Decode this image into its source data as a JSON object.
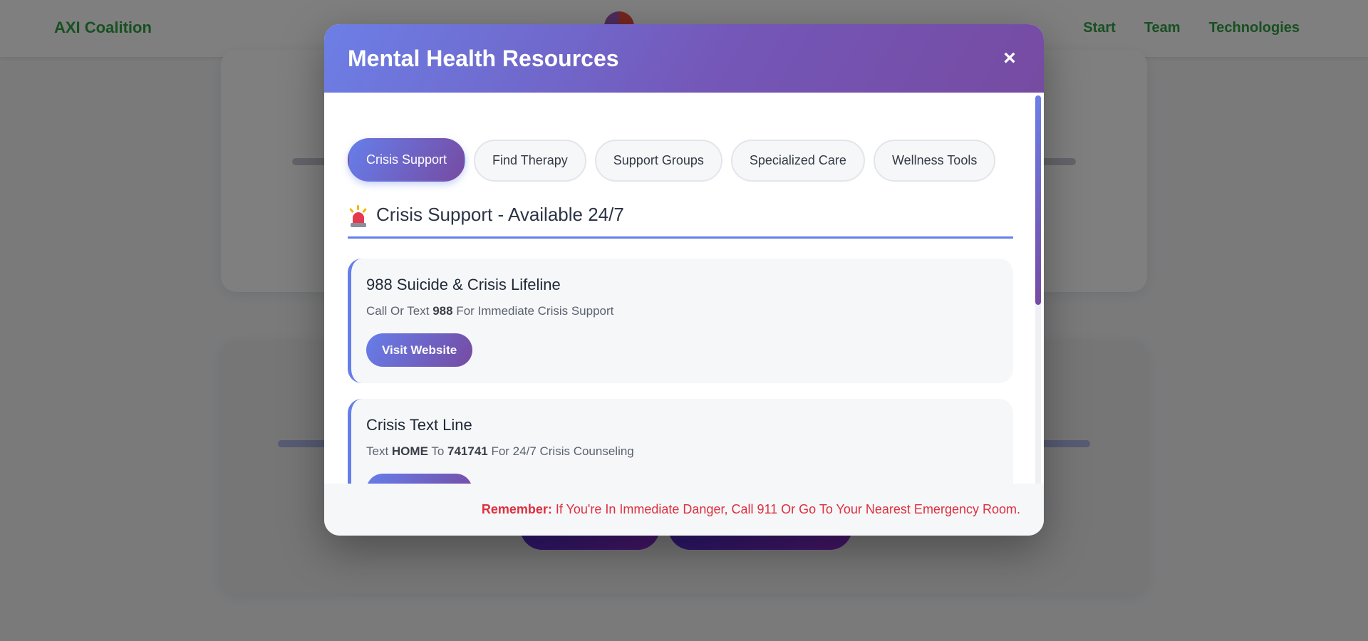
{
  "background": {
    "brand": "AXI Coalition",
    "nav_links": [
      "Start",
      "Team",
      "Technologies"
    ]
  },
  "modal": {
    "title": "Mental Health Resources",
    "close_label": "×",
    "tabs": [
      {
        "label": "Crisis Support",
        "active": true
      },
      {
        "label": "Find Therapy",
        "active": false
      },
      {
        "label": "Support Groups",
        "active": false
      },
      {
        "label": "Specialized Care",
        "active": false
      },
      {
        "label": "Wellness Tools",
        "active": false
      }
    ],
    "section": {
      "icon": "siren-icon",
      "title": "Crisis Support - Available 24/7"
    },
    "resources": [
      {
        "title": "988 Suicide & Crisis Lifeline",
        "desc_parts": [
          "Call Or Text ",
          "988",
          " For Immediate Crisis Support"
        ],
        "button": "Visit Website"
      },
      {
        "title": "Crisis Text Line",
        "desc_parts": [
          "Text ",
          "HOME",
          " To ",
          "741741",
          " For 24/7 Crisis Counseling"
        ],
        "button": "Visit Website"
      }
    ],
    "footer": {
      "label": "Remember:",
      "text": " If You're In Immediate Danger, Call 911 Or Go To Your Nearest Emergency Room."
    }
  },
  "colors": {
    "accent_start": "#667eea",
    "accent_end": "#764ba2",
    "danger": "#dc2f3e"
  }
}
